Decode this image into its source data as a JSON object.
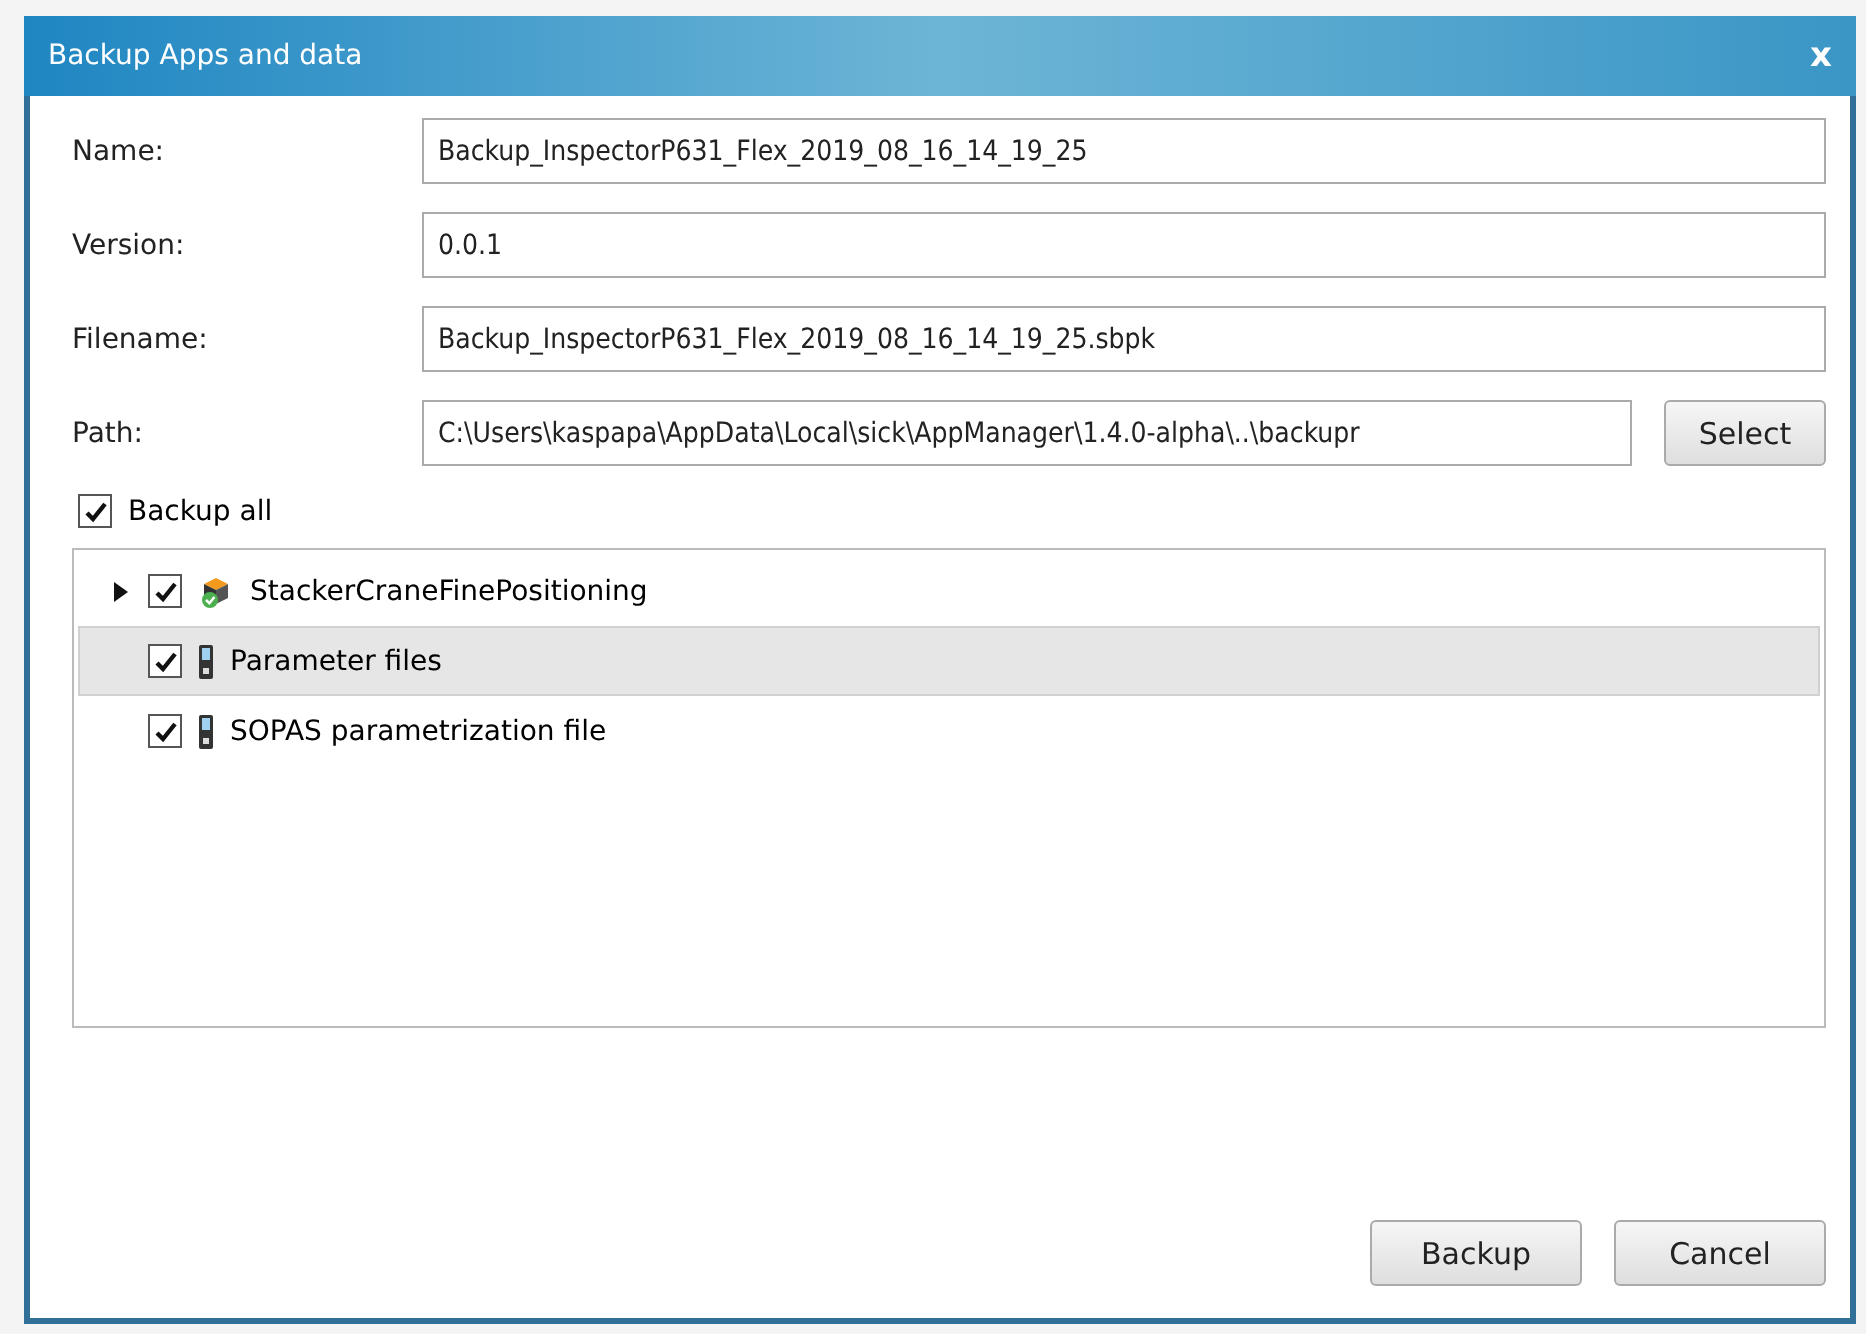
{
  "window": {
    "title": "Backup Apps and data",
    "close": "x"
  },
  "fields": [
    {
      "label": "Name:",
      "value": "Backup_InspectorP631_Flex_2019_08_16_14_19_25"
    },
    {
      "label": "Version:",
      "value": "0.0.1"
    },
    {
      "label": "Filename:",
      "value": "Backup_InspectorP631_Flex_2019_08_16_14_19_25.sbpk"
    },
    {
      "label": "Path:",
      "value": "C:\\Users\\kaspapa\\AppData\\Local\\sick\\AppManager\\1.4.0-alpha\\..\\backupr",
      "button": "Select"
    }
  ],
  "backup_all": {
    "label": "Backup all",
    "checked": true
  },
  "tree": [
    {
      "kind": "app",
      "label": "StackerCraneFinePositioning",
      "checked": true,
      "expanded": false,
      "selected": false
    },
    {
      "kind": "file",
      "label": "Parameter files",
      "checked": true,
      "selected": true
    },
    {
      "kind": "file",
      "label": "SOPAS parametrization file",
      "checked": true,
      "selected": false
    }
  ],
  "buttons": [
    "Backup",
    "Cancel"
  ]
}
